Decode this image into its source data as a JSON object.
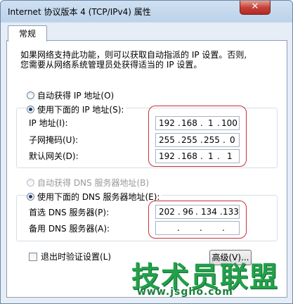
{
  "window": {
    "title": "Internet 协议版本 4 (TCP/IPv4) 属性",
    "close_label": "✕"
  },
  "tab": {
    "label": "常规"
  },
  "description": {
    "line1": "如果网络支持此功能，则可以获取自动指派的 IP 设置。否则,",
    "line2": "您需要从网络系统管理员处获得适当的 IP 设置。"
  },
  "ip_section": {
    "auto_radio_label": "自动获得 IP 地址(O)",
    "manual_radio_label": "使用下面的 IP 地址(S):",
    "fields": [
      {
        "label": "IP 地址(I):",
        "octets": [
          "192",
          "168",
          "1",
          "100"
        ]
      },
      {
        "label": "子网掩码(U):",
        "octets": [
          "255",
          "255",
          "255",
          "0"
        ]
      },
      {
        "label": "默认网关(D):",
        "octets": [
          "192",
          "168",
          "1",
          "1"
        ]
      }
    ]
  },
  "dns_section": {
    "auto_radio_label": "自动获得 DNS 服务器地址(B)",
    "manual_radio_label": "使用下面的 DNS 服务器地址(E):",
    "fields": [
      {
        "label": "首选 DNS 服务器(P):",
        "octets": [
          "202",
          "96",
          "134",
          "133"
        ]
      },
      {
        "label": "备用 DNS 服务器(A):",
        "octets": [
          "",
          "",
          "",
          ""
        ]
      }
    ]
  },
  "validate_checkbox_label": "退出时验证设置(L)",
  "advanced_button_label": "高级(V)...",
  "watermark": {
    "title": "技术员联盟",
    "url": "www.jsgho.com"
  }
}
